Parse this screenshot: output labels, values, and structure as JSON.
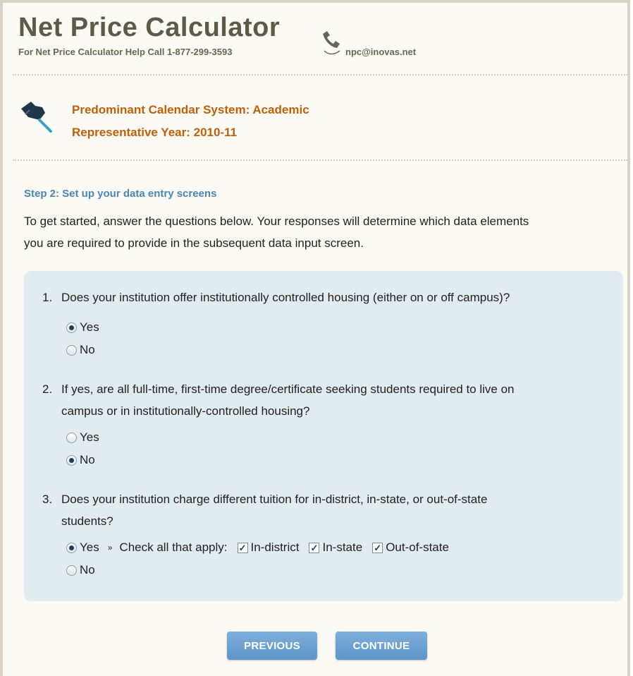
{
  "header": {
    "title": "Net Price Calculator",
    "helpline": "For Net Price Calculator Help Call 1-877-299-3593",
    "email": "npc@inovas.net"
  },
  "info": {
    "calendar": "Predominant Calendar System: Academic",
    "year": "Representative Year: 2010-11"
  },
  "step": {
    "heading": "Step 2: Set up your data entry screens",
    "intro_line1": "To get started, answer the questions below. Your responses will determine which data elements",
    "intro_line2": "you are required to provide in the subsequent data input screen."
  },
  "questions": [
    {
      "num": "1.",
      "text_line1": "Does your institution offer institutionally controlled housing (either on or off campus)?",
      "yes_label": "Yes",
      "no_label": "No",
      "selected": "Yes"
    },
    {
      "num": "2.",
      "text_line1": "If yes, are all full-time, first-time degree/certificate seeking students required to live on",
      "text_line2": "campus or in institutionally-controlled housing?",
      "yes_label": "Yes",
      "no_label": "No",
      "selected": "No"
    },
    {
      "num": "3.",
      "text_line1": "Does your institution charge different tuition for in-district, in-state, or out-of-state",
      "text_line2": "students?",
      "yes_label": "Yes",
      "no_label": "No",
      "selected": "Yes",
      "arrow": "»",
      "check_prompt": "Check all that apply:",
      "checks": [
        {
          "label": "In-district",
          "checked": true
        },
        {
          "label": "In-state",
          "checked": true
        },
        {
          "label": "Out-of-state",
          "checked": true
        }
      ]
    }
  ],
  "buttons": {
    "previous": "PREVIOUS",
    "continue": "CONTINUE"
  },
  "icons": {
    "phone": "phone-icon",
    "pin": "pushpin-icon"
  },
  "colors": {
    "accent_orange": "#c0600a",
    "step_blue": "#4a86b8",
    "panel_bg": "#e1ebf0",
    "button_blue": "#6a9fd0"
  }
}
